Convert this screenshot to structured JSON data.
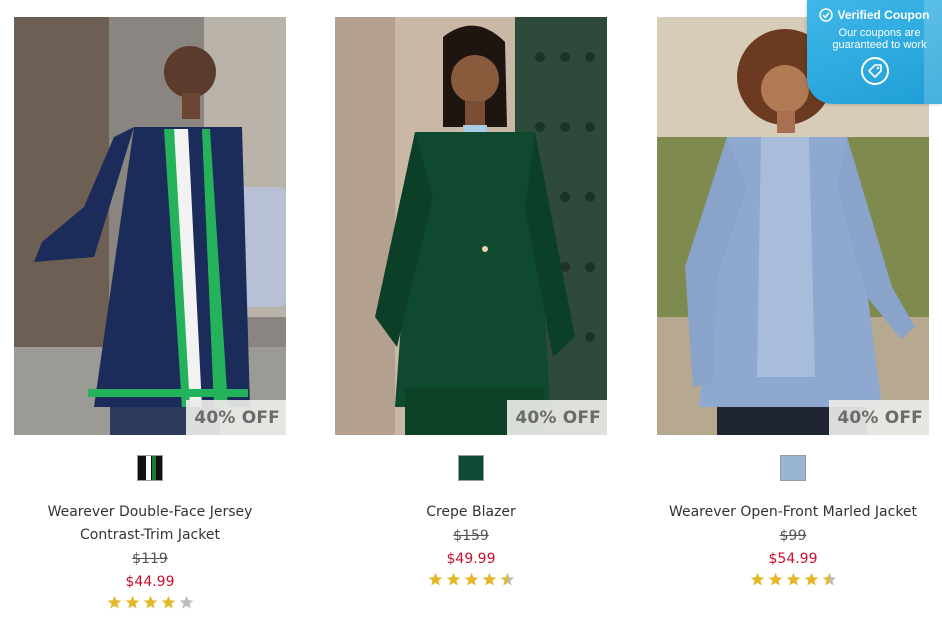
{
  "products": [
    {
      "title": "Wearever Double-Face Jersey Contrast-Trim Jacket",
      "badge": "40% OFF",
      "original_price": "$119",
      "sale_price": "$44.99",
      "rating": 4.0,
      "swatch": {
        "colors": [
          "#111111",
          "#ffffff",
          "#1e7a3c"
        ]
      }
    },
    {
      "title": "Crepe Blazer",
      "badge": "40% OFF",
      "original_price": "$159",
      "sale_price": "$49.99",
      "rating": 4.5,
      "swatch": {
        "colors": [
          "#0f4a34"
        ]
      }
    },
    {
      "title": "Wearever Open-Front Marled Jacket",
      "badge": "40% OFF",
      "original_price": "$99",
      "sale_price": "$54.99",
      "rating": 4.5,
      "swatch": {
        "colors": [
          "#9ab4d4"
        ]
      }
    }
  ],
  "coupon": {
    "title": "Verified Coupon",
    "subtitle": "Our coupons are guaranteed to work",
    "icon": "coupon-tag-icon"
  },
  "colors": {
    "sale_price": "#c8102e",
    "star_filled": "#e5b82a",
    "star_empty": "#bdbdbd",
    "coupon_bg": "#2aa6dc"
  }
}
